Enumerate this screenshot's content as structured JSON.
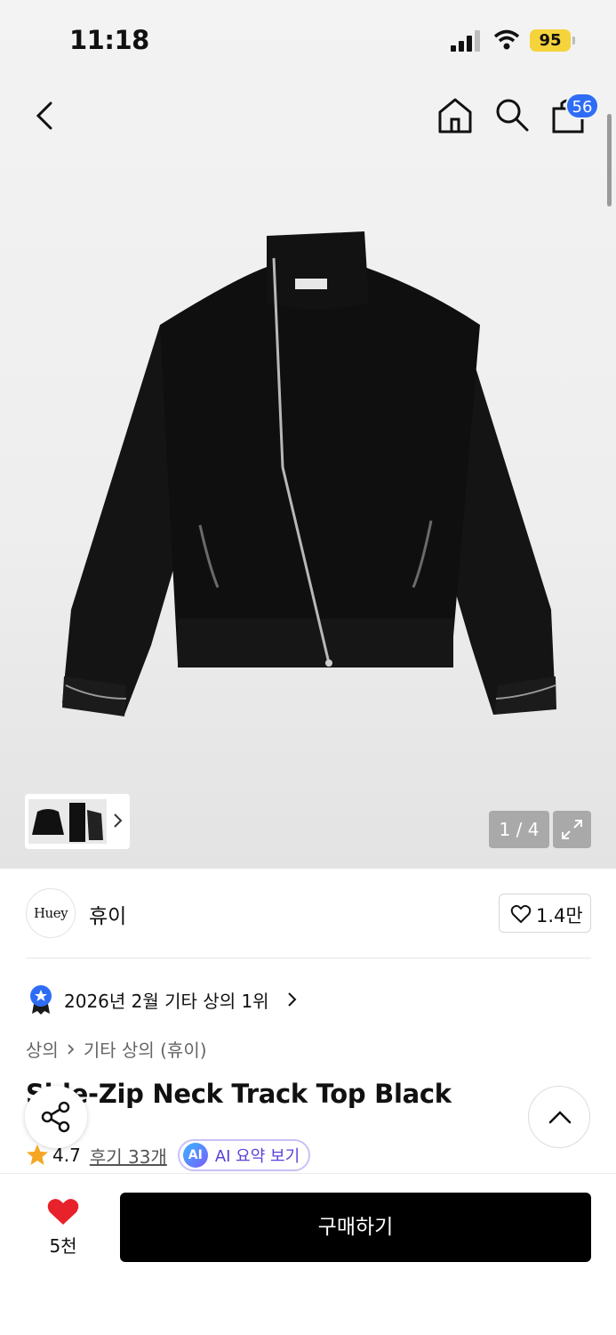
{
  "status_bar": {
    "time": "11:18",
    "battery": "95"
  },
  "nav": {
    "cart_count": "56"
  },
  "gallery": {
    "pager": "1 / 4"
  },
  "brand": {
    "logo_text": "Huey",
    "name": "휴이",
    "like_count": "1.4만"
  },
  "ranking": {
    "text": "2026년 2월 기타 상의 1위"
  },
  "breadcrumb": {
    "items": [
      "상의",
      "기타 상의 (휴이)"
    ]
  },
  "product": {
    "title": "Side-Zip Neck Track Top Black",
    "rating": "4.7",
    "reviews": "후기 33개",
    "ai_badge": "AI",
    "ai_summary": "AI 요약 보기"
  },
  "bottom": {
    "wish_count": "5천",
    "buy_label": "구매하기"
  },
  "colors": {
    "accent_blue": "#2f6cf6",
    "heart_red": "#e8222a",
    "battery_yellow": "#f5d33a",
    "ai_purple": "#5a3fd8"
  },
  "icons": [
    "back-icon",
    "home-icon",
    "search-icon",
    "bag-icon",
    "expand-icon",
    "heart-outline-icon",
    "ranking-badge-icon",
    "chevron-right-icon",
    "share-icon",
    "chevron-up-icon",
    "star-icon",
    "heart-filled-icon"
  ]
}
